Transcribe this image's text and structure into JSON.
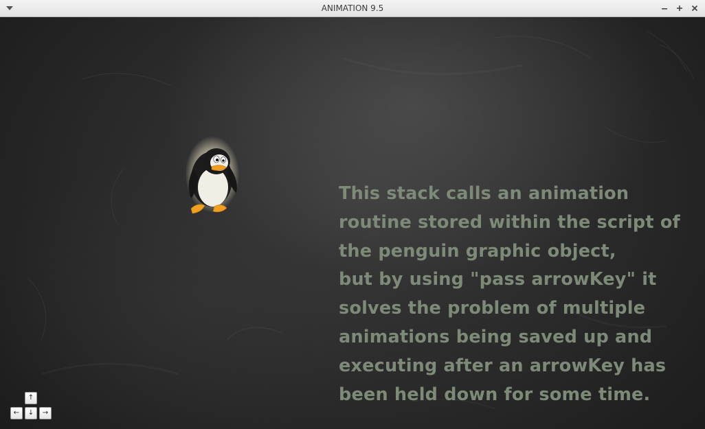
{
  "window": {
    "title": "ANIMATION 9.5"
  },
  "card": {
    "background_color": "#2c2c2c",
    "text_color": "#7e8a78",
    "message_lines": [
      "This stack calls an animation",
      "routine stored within the script of",
      "the penguin graphic object,",
      "but by using \"pass arrowKey\" it",
      "solves the problem of multiple",
      "animations being saved up and",
      "executing after an arrowKey has",
      "been held down for some time."
    ]
  },
  "arrow_keys": {
    "up": "↑",
    "left": "←",
    "down": "↓",
    "right": "→"
  },
  "icons": {
    "menu": "chevron-down-icon",
    "minimize": "minimize-icon",
    "maximize": "maximize-icon",
    "close": "close-icon",
    "sprite": "penguin-icon"
  }
}
